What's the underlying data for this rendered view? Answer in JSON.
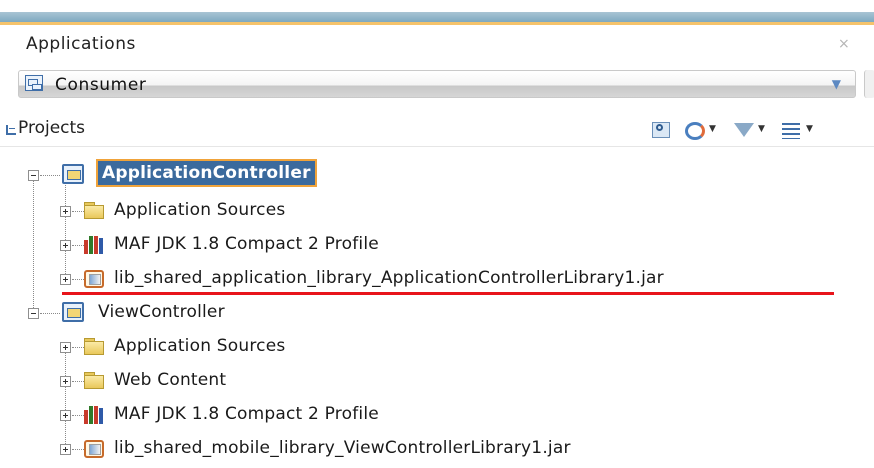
{
  "panel": {
    "title": "Applications",
    "close_symbol": "×"
  },
  "app_selector": {
    "value": "Consumer"
  },
  "projects_header": {
    "label": "Projects"
  },
  "tree": {
    "projects": [
      {
        "name": "ApplicationController",
        "selected": true,
        "children": [
          {
            "label": "Application Sources",
            "icon": "folder-icon"
          },
          {
            "label": "MAF JDK 1.8 Compact 2 Profile",
            "icon": "library-icon"
          },
          {
            "label": "lib_shared_application_library_ApplicationControllerLibrary1.jar",
            "icon": "jar-icon",
            "highlighted": true
          }
        ]
      },
      {
        "name": "ViewController",
        "selected": false,
        "children": [
          {
            "label": "Application Sources",
            "icon": "folder-icon"
          },
          {
            "label": "Web Content",
            "icon": "folder-icon"
          },
          {
            "label": "MAF JDK 1.8 Compact 2 Profile",
            "icon": "library-icon"
          },
          {
            "label": "lib_shared_mobile_library_ViewControllerLibrary1.jar",
            "icon": "jar-icon"
          }
        ]
      }
    ]
  },
  "colors": {
    "selection": "#3b6a9d",
    "selection_border": "#f0a33a",
    "highlight_underline": "#e8141b"
  }
}
